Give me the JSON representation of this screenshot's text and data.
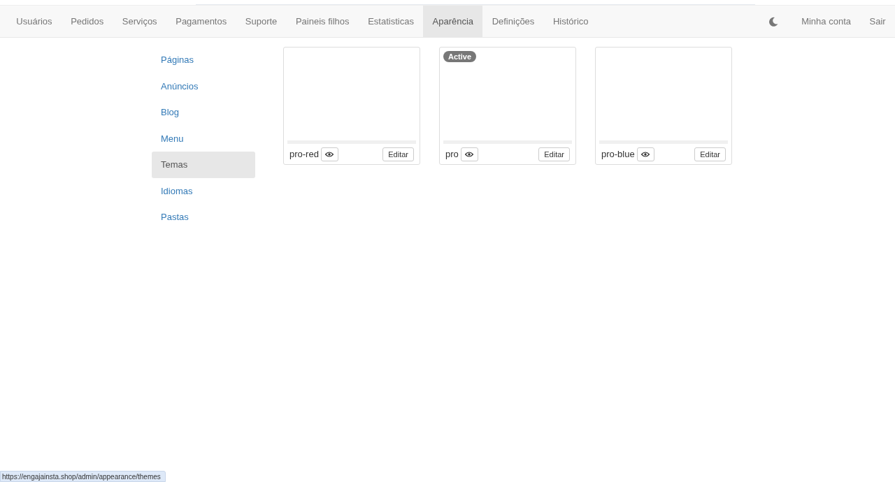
{
  "navbar": {
    "items": [
      {
        "label": "Usuários",
        "selected": false
      },
      {
        "label": "Pedidos",
        "selected": false
      },
      {
        "label": "Serviços",
        "selected": false
      },
      {
        "label": "Pagamentos",
        "selected": false
      },
      {
        "label": "Suporte",
        "selected": false
      },
      {
        "label": "Paineis filhos",
        "selected": false
      },
      {
        "label": "Estatisticas",
        "selected": false
      },
      {
        "label": "Aparência",
        "selected": true
      },
      {
        "label": "Definições",
        "selected": false
      },
      {
        "label": "Histórico",
        "selected": false
      }
    ],
    "right_items": [
      "Minha conta",
      "Sair"
    ]
  },
  "sidebar": {
    "items": [
      {
        "label": "Páginas",
        "selected": false
      },
      {
        "label": "Anúncios",
        "selected": false
      },
      {
        "label": "Blog",
        "selected": false
      },
      {
        "label": "Menu",
        "selected": false
      },
      {
        "label": "Temas",
        "selected": true
      },
      {
        "label": "Idiomas",
        "selected": false
      },
      {
        "label": "Pastas",
        "selected": false
      }
    ]
  },
  "themes": [
    {
      "name": "pro-red",
      "active": false,
      "button": "Editar"
    },
    {
      "name": "pro",
      "active": true,
      "button": "Editar"
    },
    {
      "name": "pro-blue",
      "active": false,
      "button": "Editar"
    }
  ],
  "active_badge": "Active",
  "status_url": "https://engajainsta.shop/admin/appearance/themes"
}
